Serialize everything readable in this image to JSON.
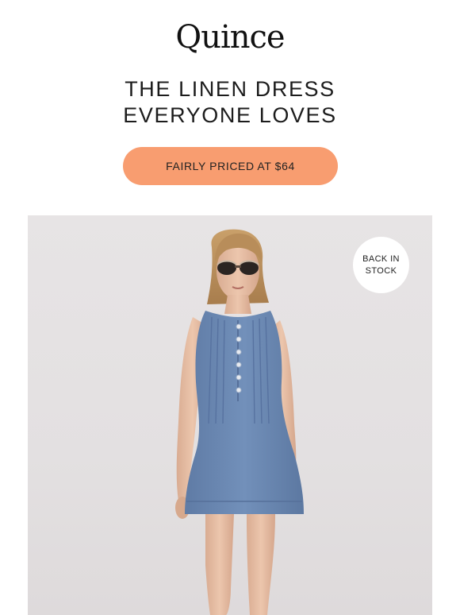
{
  "brand": {
    "logo_text": "Quince"
  },
  "headline": {
    "line1": "THE LINEN DRESS",
    "line2": "EVERYONE LOVES"
  },
  "cta": {
    "label": "FAIRLY PRICED AT $64"
  },
  "hero": {
    "image_label": "woman-in-blue-linen-dress",
    "badge": {
      "line1": "BACK IN",
      "line2": "STOCK"
    }
  },
  "colors": {
    "cta_background": "#f89d70",
    "hero_background": "#e4e1e2",
    "dress": "#6f8cb6",
    "text": "#1a1a1a"
  }
}
